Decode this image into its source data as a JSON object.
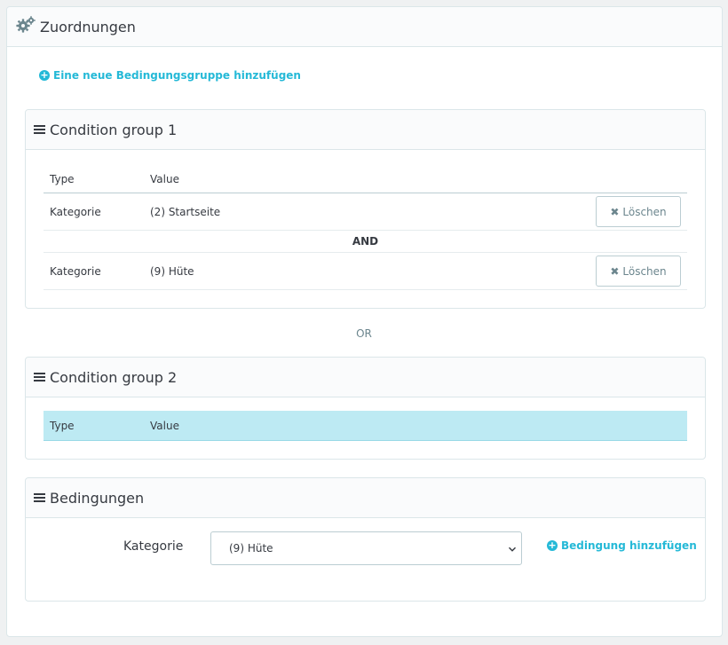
{
  "header": {
    "title": "Zuordnungen"
  },
  "add_group_link": "Eine neue Bedingungsgruppe hinzufügen",
  "groups": [
    {
      "title": "Condition group 1",
      "columns": {
        "type": "Type",
        "value": "Value"
      },
      "rows": [
        {
          "type": "Kategorie",
          "value": "(2) Startseite",
          "delete": "Löschen"
        },
        {
          "type": "Kategorie",
          "value": "(9) Hüte",
          "delete": "Löschen"
        }
      ],
      "joiner": "AND"
    },
    {
      "title": "Condition group 2",
      "columns": {
        "type": "Type",
        "value": "Value"
      }
    }
  ],
  "or_label": "OR",
  "conditions": {
    "title": "Bedingungen",
    "label": "Kategorie",
    "selected": "(9) Hüte",
    "add_link": "Bedingung hinzufügen"
  },
  "colors": {
    "accent": "#25b9d7",
    "highlight": "#bdeaf3",
    "text": "#363a41"
  }
}
